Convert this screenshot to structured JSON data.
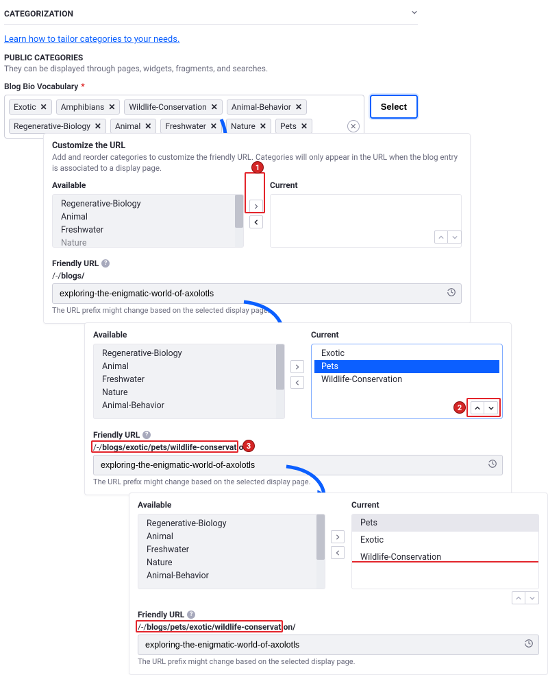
{
  "categorization": {
    "header": "CATEGORIZATION",
    "link": "Learn how to tailor categories to your needs.",
    "public_title": "PUBLIC CATEGORIES",
    "public_desc": "They can be displayed through pages, widgets, fragments, and searches.",
    "vocab_label": "Blog Bio Vocabulary",
    "tags": [
      "Exotic",
      "Amphibians",
      "Wildlife-Conservation",
      "Animal-Behavior",
      "Regenerative-Biology",
      "Animal",
      "Freshwater",
      "Nature",
      "Pets"
    ],
    "select_btn": "Select"
  },
  "card_common": {
    "title": "Customize the URL",
    "desc": "Add and reorder categories to customize the friendly URL. Categories will only appear in the URL when the blog entry is associated to a display page.",
    "available_label": "Available",
    "current_label": "Current",
    "friendly_label": "Friendly URL",
    "url_note": "The URL prefix might change based on the selected display page."
  },
  "card1": {
    "available": [
      "Regenerative-Biology",
      "Animal",
      "Freshwater",
      "Nature"
    ],
    "current": [],
    "url_prefix_plain": "/-/",
    "url_prefix_bold": "blogs/",
    "url_value": "exploring-the-enigmatic-world-of-axolotls"
  },
  "card2": {
    "available": [
      "Regenerative-Biology",
      "Animal",
      "Freshwater",
      "Nature",
      "Animal-Behavior"
    ],
    "current": [
      "Exotic",
      "Pets",
      "Wildlife-Conservation"
    ],
    "selected": "Pets",
    "url_prefix_plain": "/-/",
    "url_prefix_bold": "blogs/exotic/pets/wildlife-conservation/",
    "url_value": "exploring-the-enigmatic-world-of-axolotls"
  },
  "card3": {
    "available": [
      "Regenerative-Biology",
      "Animal",
      "Freshwater",
      "Nature",
      "Animal-Behavior"
    ],
    "current": [
      "Pets",
      "Exotic",
      "Wildlife-Conservation"
    ],
    "selected": "Pets",
    "url_prefix_plain": "/-/",
    "url_prefix_bold": "blogs/pets/exotic/wildlife-conservation/",
    "url_value": "exploring-the-enigmatic-world-of-axolotls"
  },
  "badges": {
    "n1": "1",
    "n2": "2",
    "n3": "3"
  }
}
